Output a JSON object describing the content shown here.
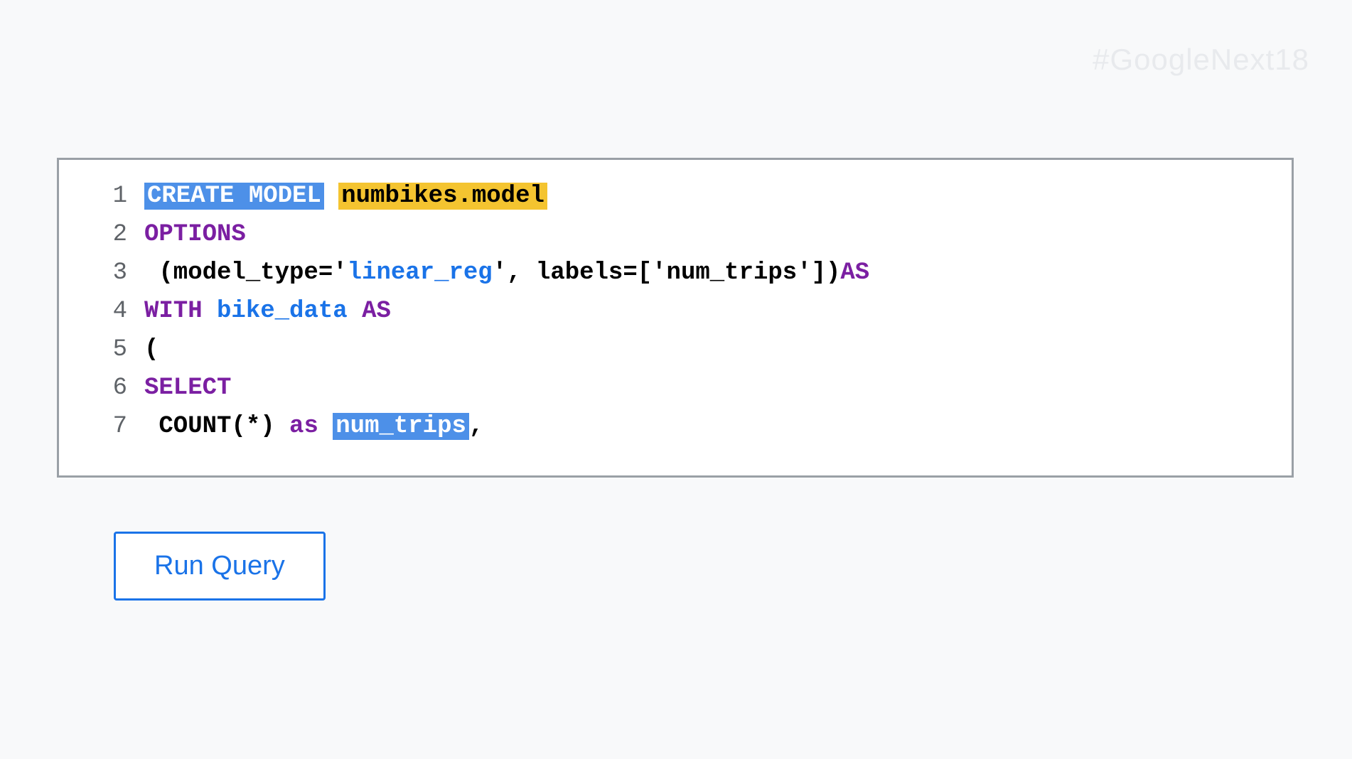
{
  "watermark": "#GoogleNext18",
  "code": {
    "lines": {
      "l1": {
        "num": "1",
        "create_model": "CREATE MODEL",
        "model_name": "numbikes.model"
      },
      "l2": {
        "num": "2",
        "options": "OPTIONS"
      },
      "l3": {
        "num": "3",
        "indent": " (model_type='",
        "str": "linear_reg",
        "rest1": "', labels=['",
        "label": "num_trips",
        "rest2": "']) ",
        "as": "AS"
      },
      "l4": {
        "num": "4",
        "with": "WITH",
        "ident": "bike_data",
        "as": "AS"
      },
      "l5": {
        "num": "5",
        "paren": "("
      },
      "l6": {
        "num": "6",
        "select": "SELECT"
      },
      "l7": {
        "num": "7",
        "count": " COUNT(*) ",
        "as": "as",
        "sp": " ",
        "num_trips": "num_trips",
        "comma": ","
      }
    }
  },
  "button": {
    "run_query": "Run Query"
  }
}
